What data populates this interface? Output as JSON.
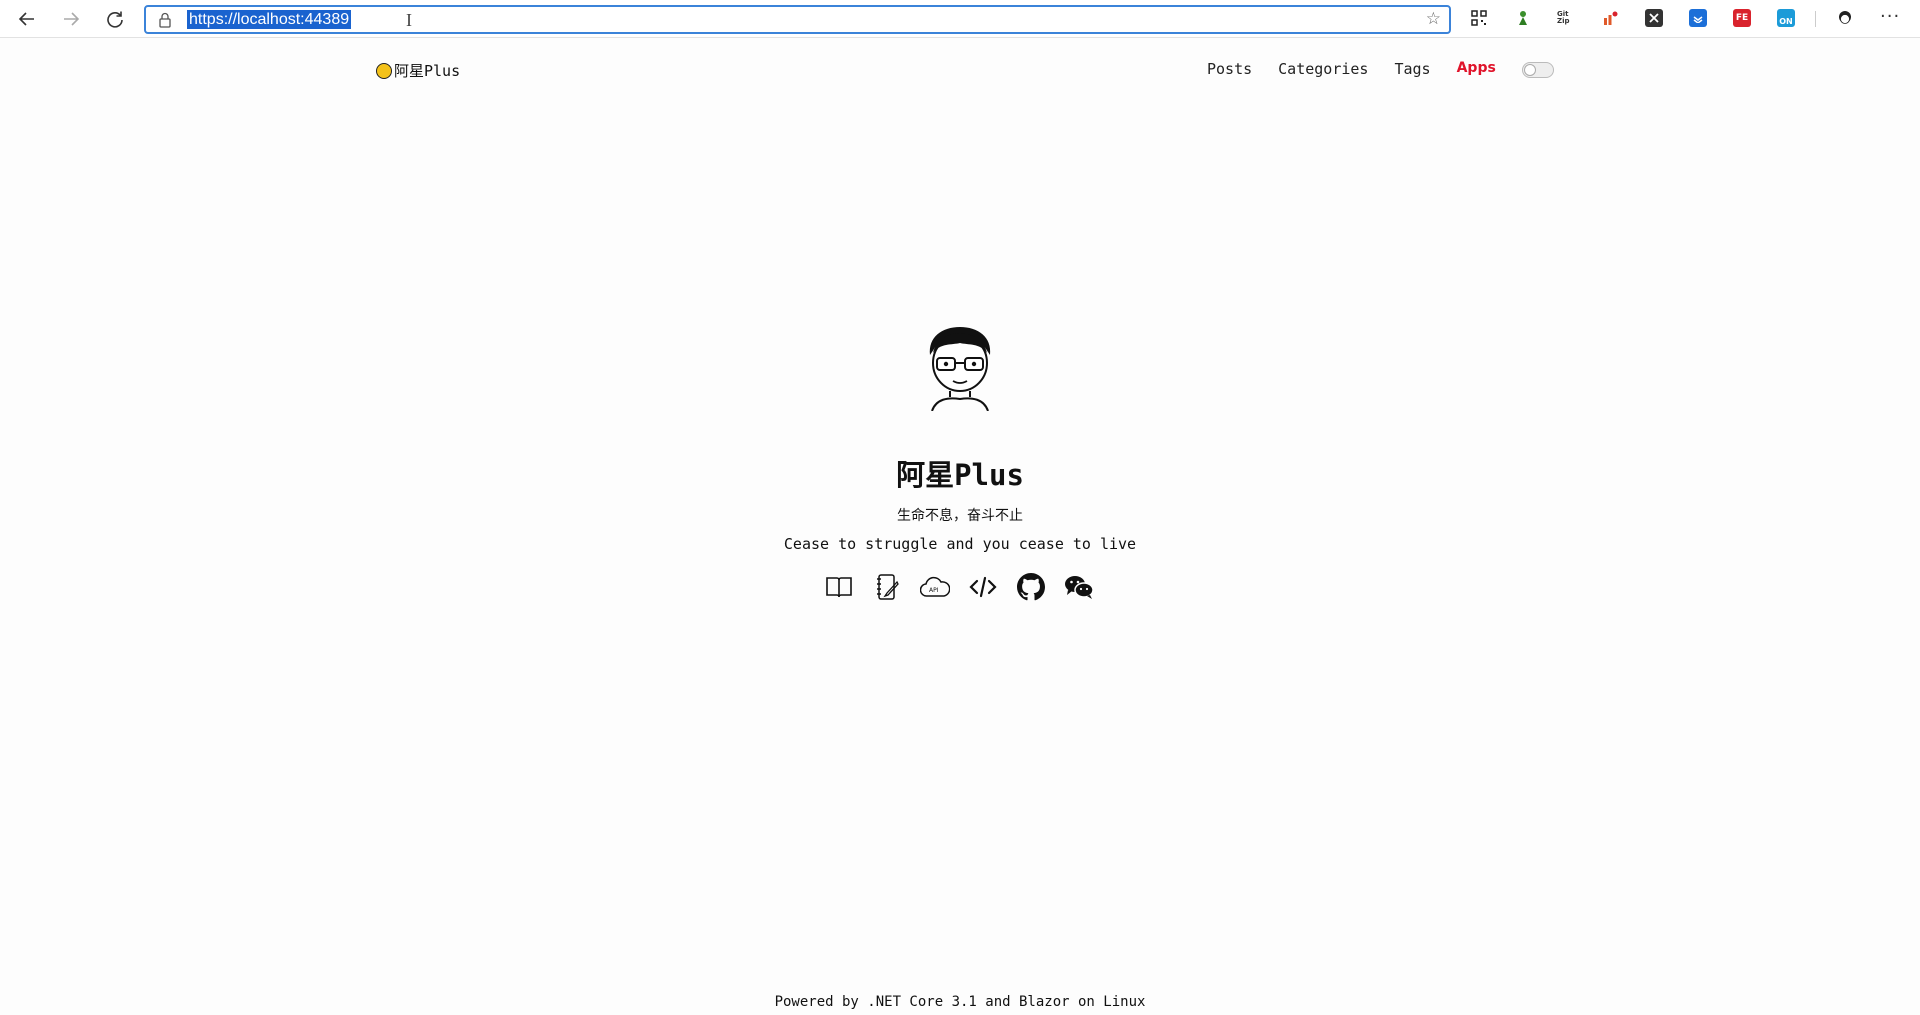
{
  "browser": {
    "url": "https://localhost:44389",
    "nav_icons": [
      "back-arrow-icon",
      "forward-arrow-icon",
      "refresh-icon"
    ],
    "extensions": [
      "qr-code-icon",
      "leaf-extension-icon",
      "gitzip-extension-icon",
      "chart-extension-icon",
      "x-extension-icon",
      "blue-extension-icon",
      "fe-extension-icon",
      "on-extension-icon",
      "profile-avatar-icon",
      "more-menu-icon"
    ],
    "ext_labels": {
      "gitzip": "Git Zip",
      "fe": "FE",
      "on": "ON"
    },
    "more_label": "···"
  },
  "site": {
    "brand": "阿星Plus",
    "nav": [
      "Posts",
      "Categories",
      "Tags",
      "Apps"
    ],
    "active_nav": "Apps",
    "accent": "#e0142b"
  },
  "hero": {
    "title": "阿星Plus",
    "motto": "生命不息，奋斗不止",
    "quote": "Cease to struggle and you cease to live",
    "icons": [
      "book-icon",
      "notebook-icon",
      "cloud-api-icon",
      "code-icon",
      "github-icon",
      "wechat-icon"
    ]
  },
  "footer": {
    "text": "Powered by .NET Core 3.1 and Blazor on Linux"
  }
}
